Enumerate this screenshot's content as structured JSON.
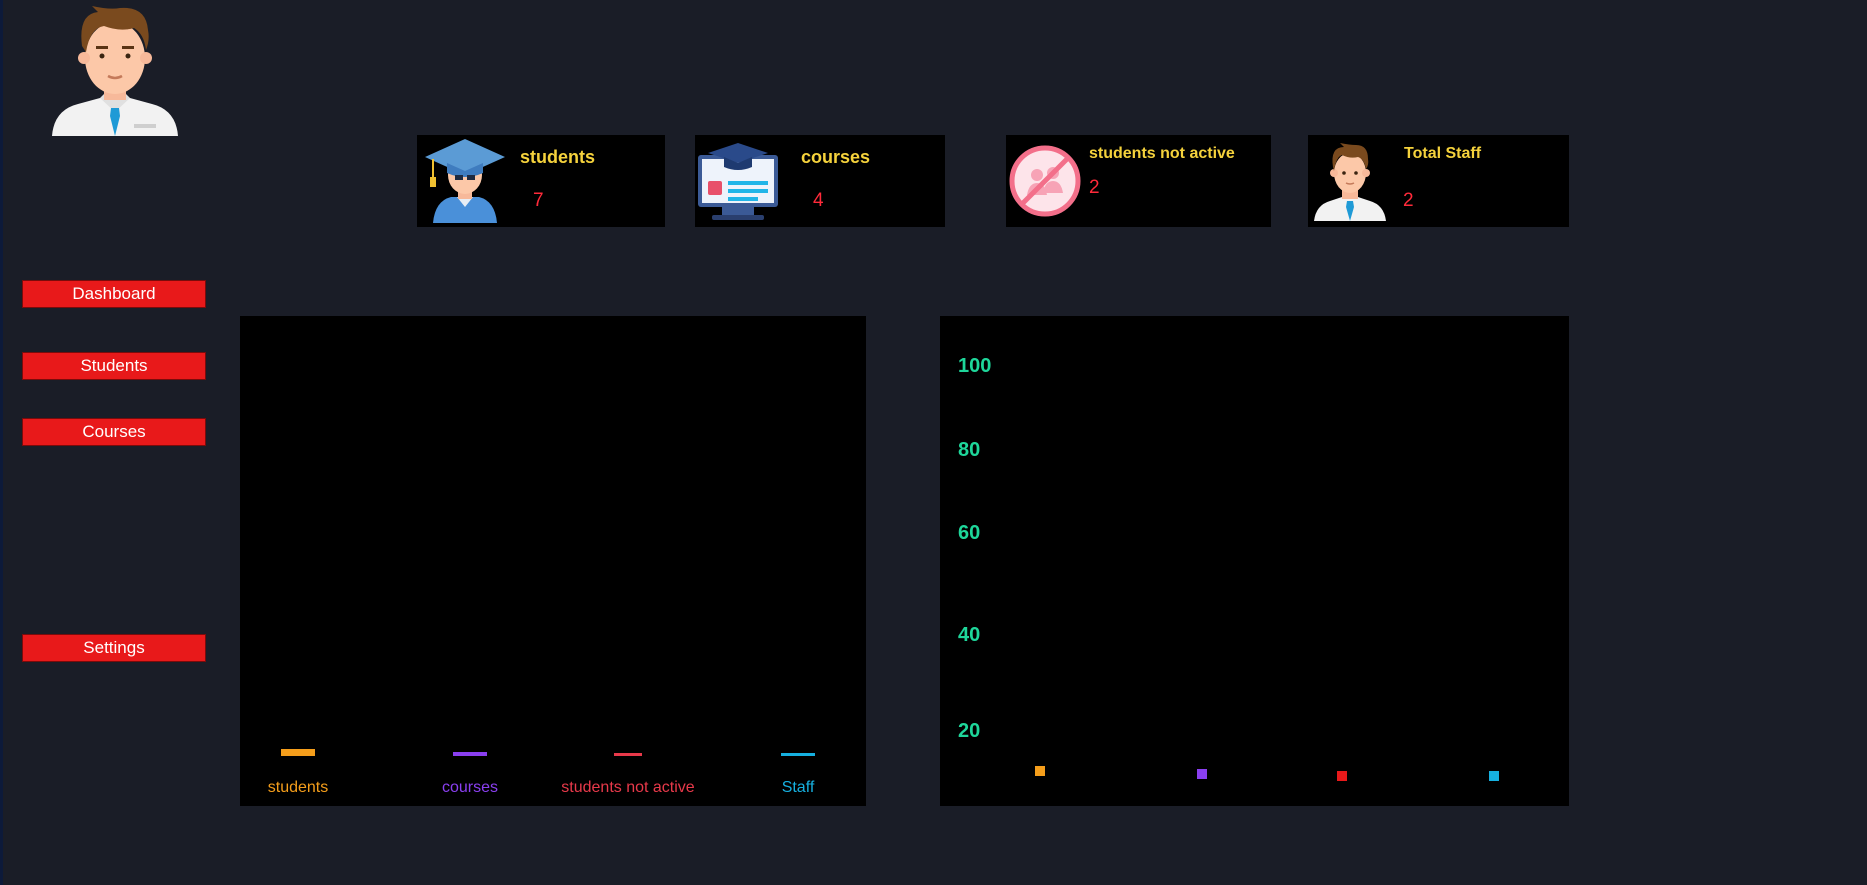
{
  "sidebar": {
    "items": [
      {
        "label": "Dashboard"
      },
      {
        "label": "Students"
      },
      {
        "label": "Courses"
      },
      {
        "label": "Settings"
      }
    ]
  },
  "cards": [
    {
      "title": "students",
      "value": "7",
      "icon": "graduate-icon"
    },
    {
      "title": "courses",
      "value": "4",
      "icon": "online-course-icon"
    },
    {
      "title": "students not active",
      "value": "2",
      "icon": "no-students-icon"
    },
    {
      "title": "Total Staff",
      "value": "2",
      "icon": "staff-icon"
    }
  ],
  "colors": {
    "background": "#1a1d27",
    "nav_button": "#e8191a",
    "card_title": "#f5d23c",
    "card_value": "#ff2a3a",
    "axis_tick": "#1ed69a"
  },
  "chart_data": [
    {
      "type": "bar",
      "categories": [
        "students",
        "courses",
        "students not active",
        "Staff"
      ],
      "values": [
        7,
        4,
        2,
        2
      ],
      "colors": [
        "#f59e1b",
        "#8a3ff0",
        "#e8394a",
        "#16b0e0"
      ],
      "ylim": [
        0,
        400
      ]
    },
    {
      "type": "scatter",
      "x": [
        1,
        2,
        3,
        4
      ],
      "values": [
        7,
        4,
        2,
        2
      ],
      "colors": [
        "#f59e1b",
        "#8a3ff0",
        "#e8191a",
        "#16b0e0"
      ],
      "yticks": [
        "20",
        "40",
        "60",
        "80",
        "100"
      ],
      "ylim": [
        0,
        110
      ]
    }
  ]
}
